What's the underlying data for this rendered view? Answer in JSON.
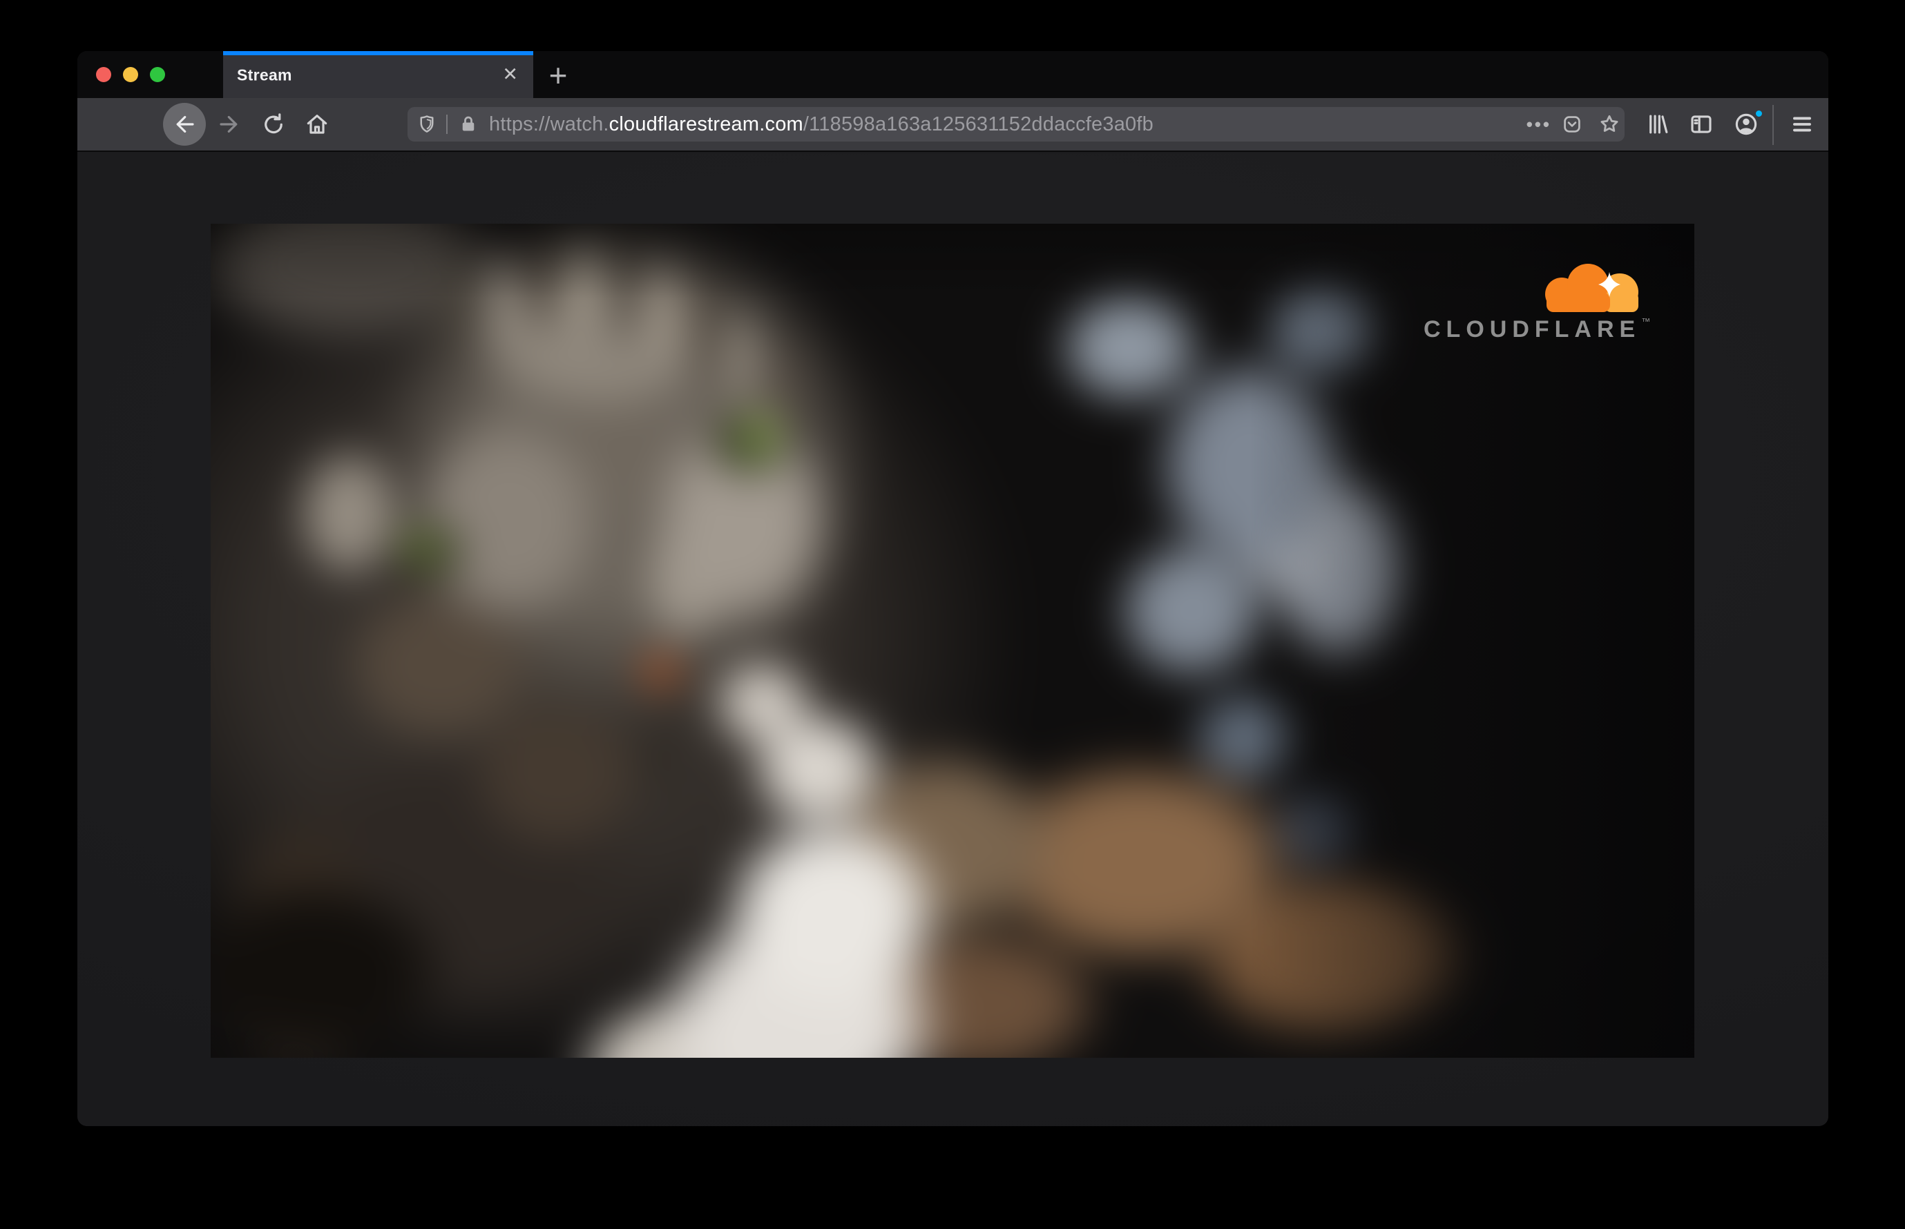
{
  "tab_bar": {
    "active_tab_label": "Stream"
  },
  "icons": {
    "close_tab": "✕",
    "new_tab": "+",
    "page_actions": "•••"
  },
  "url_bar": {
    "scheme_and_subdomain": "https://watch.",
    "domain": "cloudflarestream.com",
    "path": "/118598a163a125631152ddaccfe3a0fb"
  },
  "video": {
    "watermark_brand": "CLOUDFLARE",
    "watermark_trademark": "™"
  },
  "colors": {
    "accent_blue": "#0a84ff",
    "titlebar_black": "#0b0b0c",
    "toolbar_gray": "#3a3a3e",
    "urlbar_gray": "#4a4a4f",
    "page_background": "#1c1c1e",
    "traffic_red": "#f4615c",
    "traffic_yellow": "#f6c243",
    "traffic_green": "#2fc640",
    "cloudflare_orange": "#f6821f",
    "cloudflare_orange_light": "#fbad41",
    "profile_badge_cyan": "#00b4f5",
    "url_dim_text": "#9c9ca1",
    "url_domain_text": "#ffffff"
  }
}
